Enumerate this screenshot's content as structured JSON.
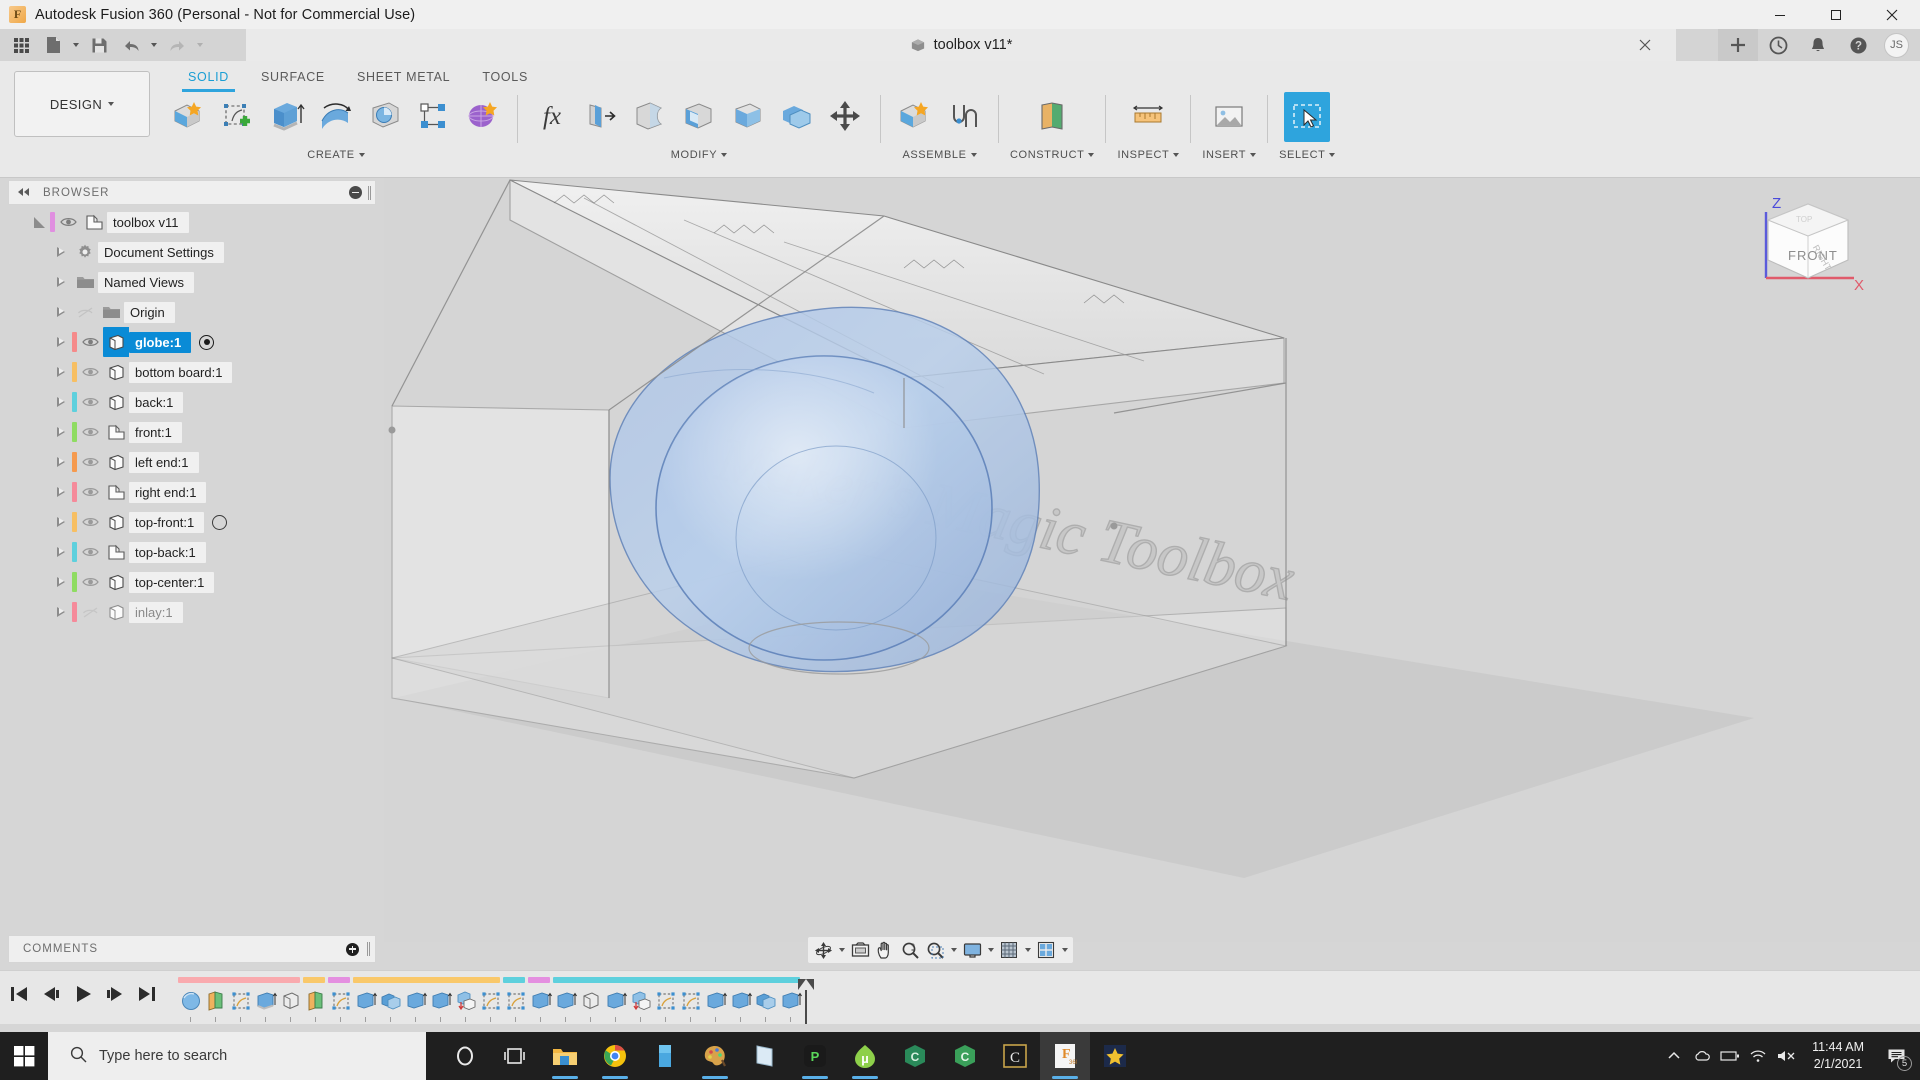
{
  "window": {
    "title": "Autodesk Fusion 360 (Personal - Not for Commercial Use)",
    "logo_letter": "F",
    "minimize_label": "Minimize",
    "maximize_label": "Maximize",
    "close_label": "Close"
  },
  "quick_access": {
    "grid_label": "Show Data Panel",
    "file_label": "File",
    "save_label": "Save",
    "undo_label": "Undo",
    "redo_label": "Redo"
  },
  "document": {
    "tab_title": "toolbox v11*",
    "close_label": "Close document"
  },
  "appbar_right": {
    "add_label": "New design",
    "history_label": "Job status",
    "notifications_label": "Notifications",
    "help_label": "Help",
    "avatar_initials": "JS"
  },
  "ribbon": {
    "workspace": "DESIGN",
    "tabs": [
      {
        "label": "SOLID",
        "active": true
      },
      {
        "label": "SURFACE",
        "active": false
      },
      {
        "label": "SHEET METAL",
        "active": false
      },
      {
        "label": "TOOLS",
        "active": false
      }
    ],
    "groups": [
      {
        "label": "CREATE",
        "has_caret": true,
        "tools": [
          {
            "name": "new-component-icon"
          },
          {
            "name": "create-sketch-icon"
          },
          {
            "name": "extrude-icon"
          },
          {
            "name": "revolve-icon"
          },
          {
            "name": "sweep-icon"
          },
          {
            "name": "pattern-icon"
          },
          {
            "name": "create-form-icon"
          }
        ]
      },
      {
        "label": "MODIFY",
        "has_caret": true,
        "tools": [
          {
            "name": "change-parameters-icon"
          },
          {
            "name": "press-pull-icon"
          },
          {
            "name": "fillet-icon"
          },
          {
            "name": "shell-icon"
          },
          {
            "name": "draft-icon"
          },
          {
            "name": "combine-icon"
          },
          {
            "name": "move-copy-icon"
          }
        ]
      },
      {
        "label": "ASSEMBLE",
        "has_caret": true,
        "tools": [
          {
            "name": "new-component-assemble-icon"
          },
          {
            "name": "joint-icon"
          }
        ]
      },
      {
        "label": "CONSTRUCT",
        "has_caret": true,
        "tools": [
          {
            "name": "offset-plane-icon"
          }
        ]
      },
      {
        "label": "INSPECT",
        "has_caret": true,
        "tools": [
          {
            "name": "measure-icon"
          }
        ]
      },
      {
        "label": "INSERT",
        "has_caret": true,
        "tools": [
          {
            "name": "insert-image-icon"
          }
        ]
      },
      {
        "label": "SELECT",
        "has_caret": true,
        "tools": [
          {
            "name": "select-icon",
            "selected": true
          }
        ]
      }
    ]
  },
  "browser": {
    "header": "BROWSER",
    "collapse_label": "Collapse browser",
    "root": {
      "label": "toolbox v11",
      "color": "#e08fe0",
      "icon": "component-icon",
      "visible": true
    },
    "items": [
      {
        "label": "Document Settings",
        "icon": "gear-icon",
        "color": null,
        "eye": "none",
        "indent": 1
      },
      {
        "label": "Named Views",
        "icon": "folder-icon",
        "color": null,
        "eye": "none",
        "indent": 1
      },
      {
        "label": "Origin",
        "icon": "folder-icon",
        "color": null,
        "eye": "hidden",
        "indent": 1
      },
      {
        "label": "globe:1",
        "icon": "body-icon",
        "color": "#f58a8a",
        "eye": "visible",
        "indent": 1,
        "selected": true,
        "badge": "dot"
      },
      {
        "label": "bottom board:1",
        "icon": "body-icon",
        "color": "#f7bf63",
        "eye": "visible",
        "indent": 1
      },
      {
        "label": "back:1",
        "icon": "body-icon",
        "color": "#5ed0dd",
        "eye": "visible",
        "indent": 1
      },
      {
        "label": "front:1",
        "icon": "component-icon",
        "color": "#8fdc62",
        "eye": "visible",
        "indent": 1
      },
      {
        "label": "left end:1",
        "icon": "body-icon",
        "color": "#f59a4e",
        "eye": "visible",
        "indent": 1
      },
      {
        "label": "right end:1",
        "icon": "component-icon",
        "color": "#f58a9a",
        "eye": "visible",
        "indent": 1
      },
      {
        "label": "top-front:1",
        "icon": "body-icon",
        "color": "#f7bf63",
        "eye": "visible",
        "indent": 1,
        "badge": "ring"
      },
      {
        "label": "top-back:1",
        "icon": "component-icon",
        "color": "#5ed0dd",
        "eye": "visible",
        "indent": 1
      },
      {
        "label": "top-center:1",
        "icon": "body-icon",
        "color": "#8fdc62",
        "eye": "visible",
        "indent": 1
      },
      {
        "label": "inlay:1",
        "icon": "body-icon",
        "color": "#f58a9a",
        "eye": "hidden",
        "indent": 1
      }
    ]
  },
  "canvas": {
    "engraved_text": "Maker's Magic Toolbox",
    "viewcube": {
      "front_label": "FRONT",
      "right_label": "RIGHT",
      "top_label": "TOP",
      "axis_z": "Z",
      "axis_x": "X",
      "z_color": "#5b5bdb",
      "x_color": "#e05b6b"
    }
  },
  "comments": {
    "header": "COMMENTS",
    "add_label": "Add comment"
  },
  "navbar": {
    "tools": [
      {
        "name": "orbit-icon",
        "caret": true
      },
      {
        "name": "look-at-icon",
        "caret": false
      },
      {
        "name": "pan-icon",
        "caret": false
      },
      {
        "name": "zoom-icon",
        "caret": false
      },
      {
        "name": "zoom-window-icon",
        "caret": true
      },
      {
        "name": "display-settings-icon",
        "caret": true
      },
      {
        "name": "grid-snaps-icon",
        "caret": true
      },
      {
        "name": "viewports-icon",
        "caret": true
      }
    ]
  },
  "timeline": {
    "controls": [
      {
        "name": "go-to-beginning-button"
      },
      {
        "name": "step-back-button"
      },
      {
        "name": "play-button"
      },
      {
        "name": "step-forward-button"
      },
      {
        "name": "go-to-end-button"
      }
    ],
    "bands": [
      {
        "color": "#f9aaae",
        "span": 5
      },
      {
        "color": "#f9c86a",
        "span": 1
      },
      {
        "color": "#e48fe0",
        "span": 1
      },
      {
        "color": "#f9c86a",
        "span": 6
      },
      {
        "color": "#5ed0dd",
        "span": 1
      },
      {
        "color": "#e48fe0",
        "span": 1
      },
      {
        "color": "#5ed0dd",
        "span": 7
      }
    ],
    "features": [
      "sphere-feature-icon",
      "plane-feature-icon",
      "sketch-feature-icon",
      "extrude-feature-icon",
      "body-feature-icon",
      "plane-feature-icon",
      "sketch-feature-icon",
      "extrude-feature-icon",
      "combine-feature-icon",
      "extrude-feature-icon",
      "extrude-feature-icon",
      "cut-feature-icon",
      "sketch-feature-icon",
      "sketch-feature-icon",
      "extrude-feature-icon",
      "extrude-feature-icon",
      "body-feature-icon",
      "extrude-feature-icon",
      "cut-feature-icon",
      "sketch-feature-icon",
      "sketch-feature-icon",
      "extrude-feature-icon",
      "extrude-feature-icon",
      "combine-feature-icon",
      "extrude-feature-icon"
    ]
  },
  "taskbar": {
    "start_label": "Start",
    "search_placeholder": "Type here to search",
    "apps": [
      {
        "name": "cortana-icon",
        "active": false,
        "running": false
      },
      {
        "name": "task-view-icon",
        "active": false,
        "running": false
      },
      {
        "name": "file-explorer-icon",
        "active": false,
        "running": true
      },
      {
        "name": "google-chrome-icon",
        "active": false,
        "running": true
      },
      {
        "name": "store-icon",
        "active": false,
        "running": false
      },
      {
        "name": "paint-icon",
        "active": false,
        "running": true
      },
      {
        "name": "notes-icon",
        "active": false,
        "running": false
      },
      {
        "name": "prusa-slicer-icon",
        "active": false,
        "running": true
      },
      {
        "name": "utorrent-icon",
        "active": false,
        "running": true
      },
      {
        "name": "cura-icon",
        "active": false,
        "running": false
      },
      {
        "name": "cura-green-icon",
        "active": false,
        "running": false
      },
      {
        "name": "carbide-icon",
        "active": false,
        "running": false
      },
      {
        "name": "fusion-360-icon",
        "active": true,
        "running": true
      },
      {
        "name": "star-app-icon",
        "active": false,
        "running": false
      }
    ],
    "tray": [
      {
        "name": "show-hidden-icons-chevron"
      },
      {
        "name": "onedrive-icon"
      },
      {
        "name": "battery-icon"
      },
      {
        "name": "wifi-icon"
      },
      {
        "name": "volume-muted-icon"
      }
    ],
    "clock_time": "11:44 AM",
    "clock_date": "2/1/2021",
    "notification_count": "5"
  }
}
